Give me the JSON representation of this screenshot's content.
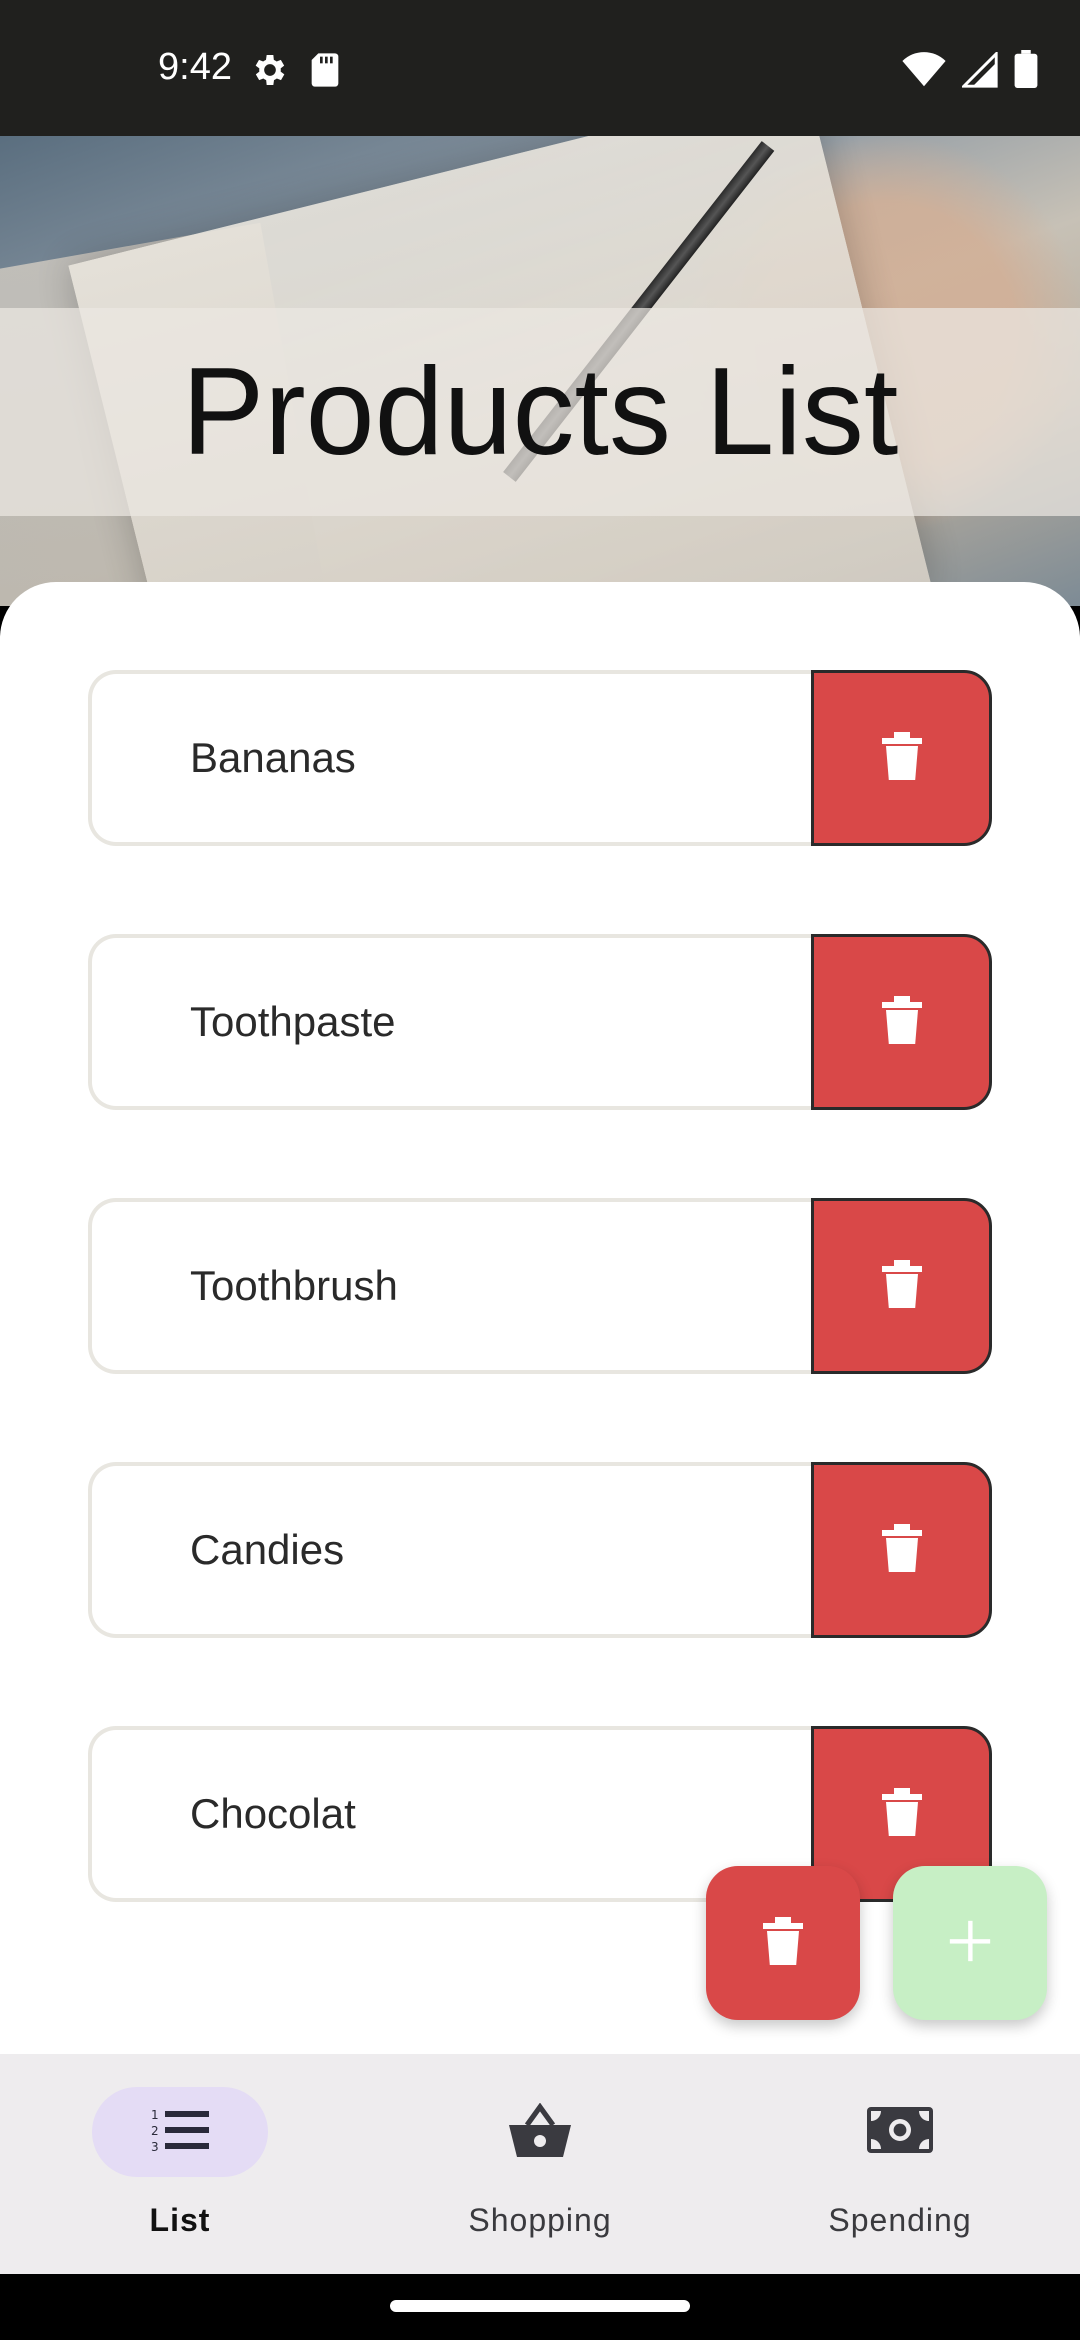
{
  "status_bar": {
    "time": "9:42",
    "left_icons": [
      "settings-icon",
      "sd-card-icon"
    ],
    "right_icons": [
      "wifi-icon",
      "signal-icon",
      "battery-icon"
    ]
  },
  "header": {
    "title": "Products List"
  },
  "products": [
    {
      "name": "Bananas"
    },
    {
      "name": "Toothpaste"
    },
    {
      "name": "Toothbrush"
    },
    {
      "name": "Candies"
    },
    {
      "name": "Chocolat"
    }
  ],
  "fabs": {
    "delete_icon": "trash-icon",
    "add_icon": "plus-icon"
  },
  "bottom_nav": {
    "items": [
      {
        "label": "List",
        "icon": "numbered-list-icon",
        "active": true
      },
      {
        "label": "Shopping",
        "icon": "basket-icon",
        "active": false
      },
      {
        "label": "Spending",
        "icon": "money-icon",
        "active": false
      }
    ]
  },
  "colors": {
    "delete_red": "#d94848",
    "add_green": "#c7efc5",
    "nav_active_pill": "#e4dcf5",
    "nav_background": "#eeecee",
    "status_bar": "#20201e"
  }
}
